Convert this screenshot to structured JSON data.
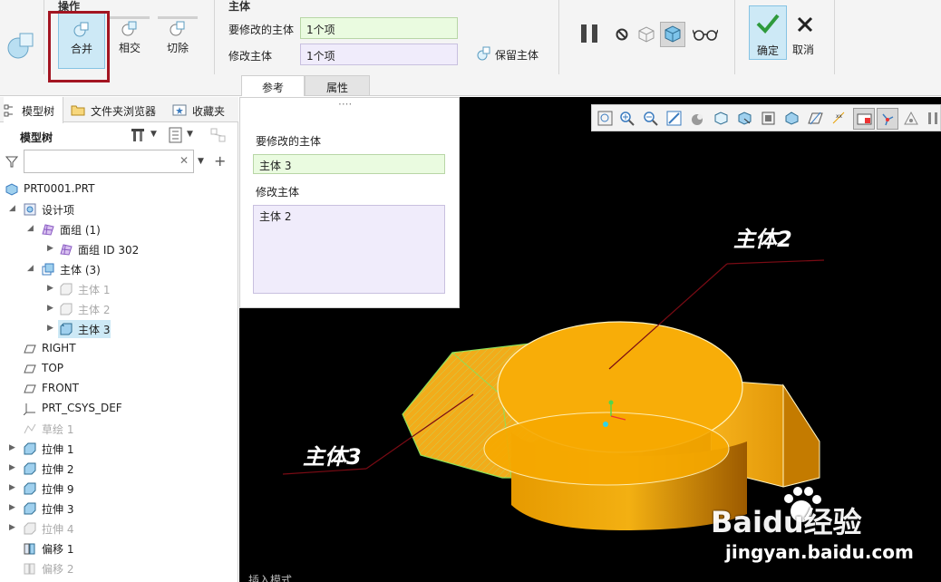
{
  "ribbon": {
    "operations_title": "操作",
    "ops": [
      "合并",
      "相交",
      "切除"
    ],
    "body_title": "主体",
    "modify_target_label": "要修改的主体",
    "modify_target_value": "1个项",
    "modifier_label": "修改主体",
    "modifier_value": "1个项",
    "keep_body_label": "保留主体",
    "ok_label": "确定",
    "cancel_label": "取消",
    "subtabs": [
      "参考",
      "属性"
    ]
  },
  "left": {
    "tabs": [
      "模型树",
      "文件夹浏览器",
      "收藏夹"
    ],
    "tree_title": "模型树",
    "search_placeholder": "",
    "tree": [
      {
        "label": "PRT0001.PRT"
      },
      {
        "label": "设计项"
      },
      {
        "label": "面组 (1)"
      },
      {
        "label": "面组 ID 302"
      },
      {
        "label": "主体 (3)"
      },
      {
        "label": "主体 1"
      },
      {
        "label": "主体 2"
      },
      {
        "label": "主体 3"
      },
      {
        "label": "RIGHT"
      },
      {
        "label": "TOP"
      },
      {
        "label": "FRONT"
      },
      {
        "label": "PRT_CSYS_DEF"
      },
      {
        "label": "草绘 1"
      },
      {
        "label": "拉伸 1"
      },
      {
        "label": "拉伸 2"
      },
      {
        "label": "拉伸 9"
      },
      {
        "label": "拉伸 3"
      },
      {
        "label": "拉伸 4"
      },
      {
        "label": "偏移 1"
      },
      {
        "label": "偏移 2"
      }
    ]
  },
  "panel": {
    "grip": "····",
    "target_title": "要修改的主体",
    "target_value": "主体 3",
    "modifier_title": "修改主体",
    "modifier_value": "主体 2"
  },
  "viewport": {
    "label_body2": "主体2",
    "label_body3": "主体3",
    "watermark_main": "Baidu经验",
    "watermark_url": "jingyan.baidu.com",
    "status_text": "插入模式"
  },
  "colors": {
    "accent": "#86c3e3",
    "highlight_box": "#a31522",
    "model_orange": "#f5a000",
    "selection_green": "#7fe05a"
  }
}
